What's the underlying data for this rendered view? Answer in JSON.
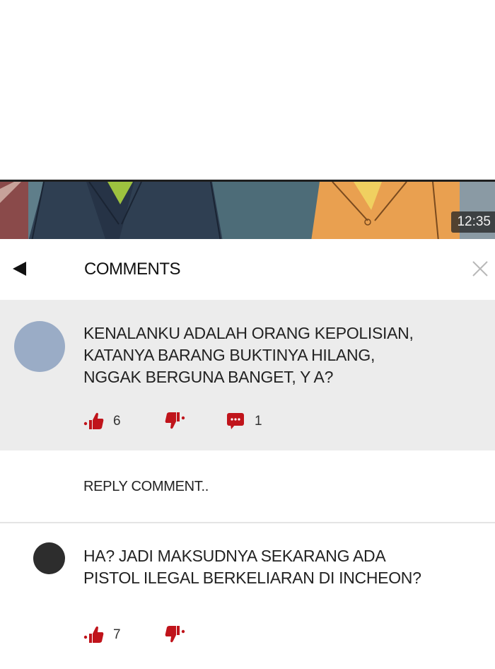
{
  "video": {
    "timestamp": "12:35"
  },
  "header": {
    "title": "COMMENTS",
    "back_icon": "back-arrow-icon",
    "close_icon": "close-icon"
  },
  "comments": [
    {
      "text": "KENALANKU ADALAH ORANG KEPOLISIAN,\nKATANYA BARANG BUKTINYA HILANG,\nNGGAK BERGUNA BANGET, Y A?",
      "likes": "6",
      "replies": "1",
      "avatar_color": "#9aacc6"
    },
    {
      "text": "HA?  JADI MAKSUDNYA SEKARANG ADA\nPISTOL ILEGAL BERKELIARAN DI INCHEON?",
      "likes": "7",
      "avatar_color": "#2d2d2d"
    }
  ],
  "reply": {
    "label": "REPLY COMMENT.."
  },
  "colors": {
    "accent_red": "#c0141b",
    "card_bg": "#ececec"
  }
}
